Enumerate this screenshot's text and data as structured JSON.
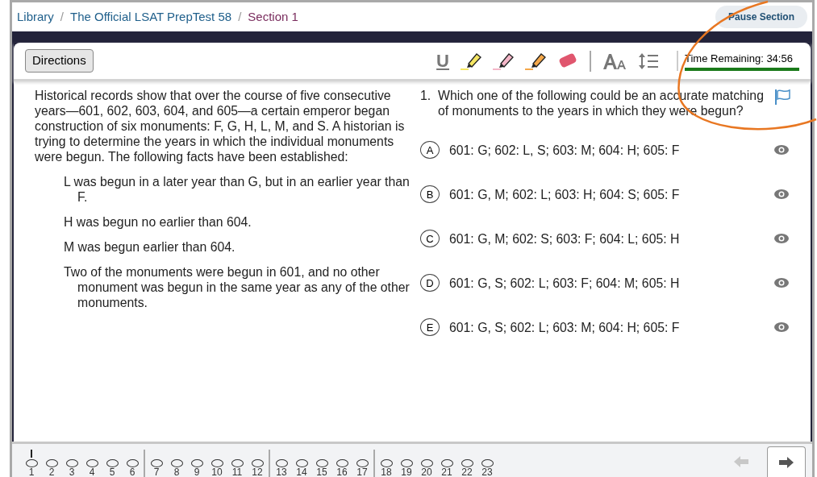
{
  "breadcrumb": [
    {
      "label": "Library",
      "current": false
    },
    {
      "separator": "/",
      "label": "The Official LSAT PrepTest 58",
      "current": false
    },
    {
      "separator": "/",
      "label": "Section 1",
      "current": true
    }
  ],
  "pause_button": "Pause Section",
  "toolbar": {
    "directions_button": "Directions",
    "tools": [
      {
        "kind": "underline",
        "label": "U"
      },
      {
        "kind": "highlighter",
        "color": "#f5e663"
      },
      {
        "kind": "highlighter",
        "color": "#f4b6c8"
      },
      {
        "kind": "highlighter",
        "color": "#f5a84a"
      },
      {
        "kind": "eraser"
      },
      {
        "kind": "divider"
      },
      {
        "kind": "font-size"
      },
      {
        "kind": "line-spacing"
      }
    ],
    "timer": {
      "text": "Time Remaining: 34:56",
      "level": 1
    }
  },
  "passage": {
    "intro": "Historical records show that over the course of five consecutive years—601, 602, 603, 604, and 605—a certain emperor began construction of six monuments: F, G, H, L, M, and S. A historian is trying to determine the years in which the individual monuments were begun. The following facts have been established:",
    "conditions": [
      "L was begun in a later year than G, but in an earlier year than F.",
      "H was begun no earlier than 604.",
      "M was begun earlier than 604.",
      "Two of the monuments were begun in 601, and no other monument was begun in the same year as any of the other monuments."
    ]
  },
  "question": {
    "number": "1.",
    "text": "Which one of the following could be an accurate matching of monuments to the years in which they were begun?",
    "flagged": false,
    "choices": [
      {
        "letter": "A",
        "text": "601: G; 602: L, S; 603: M; 604: H; 605: F",
        "selected": false
      },
      {
        "letter": "B",
        "text": "601: G, M; 602: L; 603: H; 604: S; 605: F",
        "selected": false
      },
      {
        "letter": "C",
        "text": "601: G, M; 602: S; 603: F; 604: L; 605: H",
        "selected": false
      },
      {
        "letter": "D",
        "text": "601: G, S; 602: L; 603: F; 604: M; 605: H",
        "selected": false
      },
      {
        "letter": "E",
        "text": "601: G, S; 602: L; 603: M; 604: H; 605: F",
        "selected": false
      }
    ]
  },
  "question_nav": {
    "groups": [
      {
        "questions": [
          {
            "number": "1",
            "current": true
          },
          {
            "number": "2",
            "current": false
          },
          {
            "number": "3",
            "current": false
          },
          {
            "number": "4",
            "current": false
          },
          {
            "number": "5",
            "current": false
          },
          {
            "number": "6",
            "current": false
          }
        ]
      },
      {
        "questions": [
          {
            "number": "7",
            "current": false
          },
          {
            "number": "8",
            "current": false
          },
          {
            "number": "9",
            "current": false
          },
          {
            "number": "10",
            "current": false
          },
          {
            "number": "11",
            "current": false
          },
          {
            "number": "12",
            "current": false
          }
        ]
      },
      {
        "questions": [
          {
            "number": "13",
            "current": false
          },
          {
            "number": "14",
            "current": false
          },
          {
            "number": "15",
            "current": false
          },
          {
            "number": "16",
            "current": false
          },
          {
            "number": "17",
            "current": false
          }
        ]
      },
      {
        "questions": [
          {
            "number": "18",
            "current": false
          },
          {
            "number": "19",
            "current": false
          },
          {
            "number": "20",
            "current": false
          },
          {
            "number": "21",
            "current": false
          },
          {
            "number": "22",
            "current": false
          },
          {
            "number": "23",
            "current": false
          }
        ]
      }
    ],
    "prev_disabled": true,
    "next_disabled": false
  }
}
